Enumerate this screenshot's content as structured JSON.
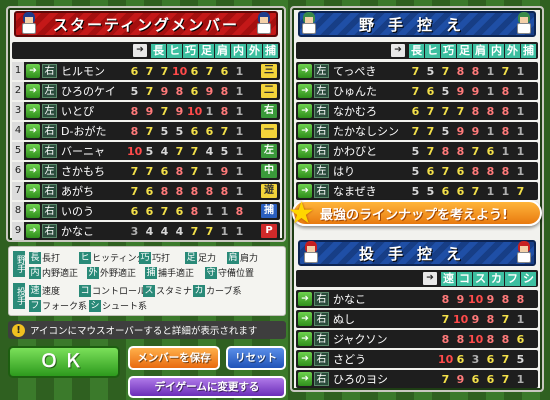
{
  "starting": {
    "title": "スターティングメンバー",
    "columns": [
      "長",
      "ヒ",
      "巧",
      "足",
      "肩",
      "内",
      "外",
      "捕"
    ],
    "rows": [
      {
        "num": "1",
        "hand": "右",
        "name": "ヒルモン",
        "stats": [
          "6",
          "7",
          "7",
          "10",
          "6",
          "7",
          "6",
          "1"
        ],
        "pos": "三",
        "pos_style": "yellow"
      },
      {
        "num": "2",
        "hand": "左",
        "name": "ひろのケイ",
        "stats": [
          "5",
          "7",
          "9",
          "8",
          "6",
          "9",
          "8",
          "1"
        ],
        "pos": "二",
        "pos_style": "yellow"
      },
      {
        "num": "3",
        "hand": "左",
        "name": "いとぴ",
        "stats": [
          "8",
          "9",
          "7",
          "9",
          "10",
          "1",
          "8",
          "1"
        ],
        "pos": "右",
        "pos_style": "green"
      },
      {
        "num": "4",
        "hand": "右",
        "name": "D-おがた",
        "stats": [
          "8",
          "7",
          "5",
          "5",
          "6",
          "6",
          "7",
          "1"
        ],
        "pos": "一",
        "pos_style": "yellow"
      },
      {
        "num": "5",
        "hand": "右",
        "name": "バーニャ",
        "stats": [
          "10",
          "5",
          "4",
          "7",
          "7",
          "4",
          "5",
          "1"
        ],
        "pos": "左",
        "pos_style": "green"
      },
      {
        "num": "6",
        "hand": "左",
        "name": "さかもち",
        "stats": [
          "7",
          "7",
          "6",
          "8",
          "7",
          "1",
          "9",
          "1"
        ],
        "pos": "中",
        "pos_style": "green"
      },
      {
        "num": "7",
        "hand": "右",
        "name": "あがち",
        "stats": [
          "7",
          "6",
          "8",
          "8",
          "8",
          "8",
          "8",
          "1"
        ],
        "pos": "遊",
        "pos_style": "yellow"
      },
      {
        "num": "8",
        "hand": "右",
        "name": "いのう",
        "stats": [
          "6",
          "6",
          "7",
          "6",
          "8",
          "1",
          "1",
          "8"
        ],
        "pos": "捕",
        "pos_style": "blue"
      },
      {
        "num": "9",
        "hand": "右",
        "name": "かなこ",
        "stats": [
          "3",
          "4",
          "4",
          "4",
          "7",
          "7",
          "1",
          "1"
        ],
        "pos": "P",
        "pos_style": "red"
      }
    ]
  },
  "bench": {
    "title": "野手控え",
    "rows": [
      {
        "hand": "左",
        "name": "てっぺき",
        "stats": [
          "7",
          "5",
          "7",
          "8",
          "8",
          "1",
          "7",
          "1"
        ]
      },
      {
        "hand": "左",
        "name": "ひゅんた",
        "stats": [
          "7",
          "6",
          "5",
          "9",
          "9",
          "1",
          "8",
          "1"
        ]
      },
      {
        "hand": "右",
        "name": "なかむろ",
        "stats": [
          "6",
          "7",
          "7",
          "7",
          "8",
          "8",
          "8",
          "1"
        ]
      },
      {
        "hand": "右",
        "name": "たかなしシン",
        "stats": [
          "7",
          "7",
          "5",
          "9",
          "9",
          "1",
          "8",
          "1"
        ]
      },
      {
        "hand": "右",
        "name": "かわびと",
        "stats": [
          "5",
          "7",
          "8",
          "8",
          "7",
          "6",
          "1",
          "1"
        ]
      },
      {
        "hand": "左",
        "name": "はり",
        "stats": [
          "5",
          "6",
          "7",
          "6",
          "8",
          "8",
          "8",
          "1"
        ]
      },
      {
        "hand": "右",
        "name": "なまぜき",
        "stats": [
          "5",
          "5",
          "6",
          "6",
          "7",
          "1",
          "1",
          "7"
        ]
      }
    ]
  },
  "banner": "最強のラインナップを考えよう!",
  "pitchers": {
    "title": "投手控え",
    "columns": [
      "速",
      "コ",
      "ス",
      "カ",
      "フ",
      "シ"
    ],
    "rows": [
      {
        "hand": "右",
        "name": "かなこ",
        "stats": [
          "8",
          "9",
          "10",
          "9",
          "8",
          "8"
        ]
      },
      {
        "hand": "右",
        "name": "ぬし",
        "stats": [
          "7",
          "10",
          "9",
          "8",
          "7",
          "1"
        ]
      },
      {
        "hand": "右",
        "name": "ジャクソン",
        "stats": [
          "8",
          "8",
          "10",
          "8",
          "8",
          "6"
        ]
      },
      {
        "hand": "右",
        "name": "さどう",
        "stats": [
          "10",
          "6",
          "3",
          "6",
          "7",
          "5"
        ]
      },
      {
        "hand": "右",
        "name": "ひろのヨシ",
        "stats": [
          "7",
          "9",
          "6",
          "6",
          "7",
          "1"
        ]
      }
    ]
  },
  "legend": {
    "fielder_tag": "野手",
    "pitcher_tag": "投手",
    "fielder_items": [
      {
        "k": "長",
        "v": "長打"
      },
      {
        "k": "ヒ",
        "v": "ヒッティング"
      },
      {
        "k": "巧",
        "v": "巧打"
      },
      {
        "k": "足",
        "v": "足力"
      },
      {
        "k": "肩",
        "v": "肩力"
      },
      {
        "k": "内",
        "v": "内野適正"
      },
      {
        "k": "外",
        "v": "外野適正"
      },
      {
        "k": "捕",
        "v": "捕手適正"
      },
      {
        "k": "守",
        "v": "守備位置"
      }
    ],
    "pitcher_items": [
      {
        "k": "速",
        "v": "速度"
      },
      {
        "k": "コ",
        "v": "コントロール"
      },
      {
        "k": "ス",
        "v": "スタミナ"
      },
      {
        "k": "カ",
        "v": "カーブ系"
      },
      {
        "k": "フ",
        "v": "フォーク系"
      },
      {
        "k": "シ",
        "v": "シュート系"
      }
    ]
  },
  "info": "アイコンにマウスオーバーすると詳細が表示されます",
  "buttons": {
    "ok": "ＯＫ",
    "save": "メンバーを保存",
    "reset": "リセット",
    "day_game": "デイゲームに変更する"
  },
  "colors": {
    "yellow": "#f3d43a",
    "green": "#3a9a3a",
    "blue": "#2a5fc0",
    "red": "#d02a2a"
  }
}
